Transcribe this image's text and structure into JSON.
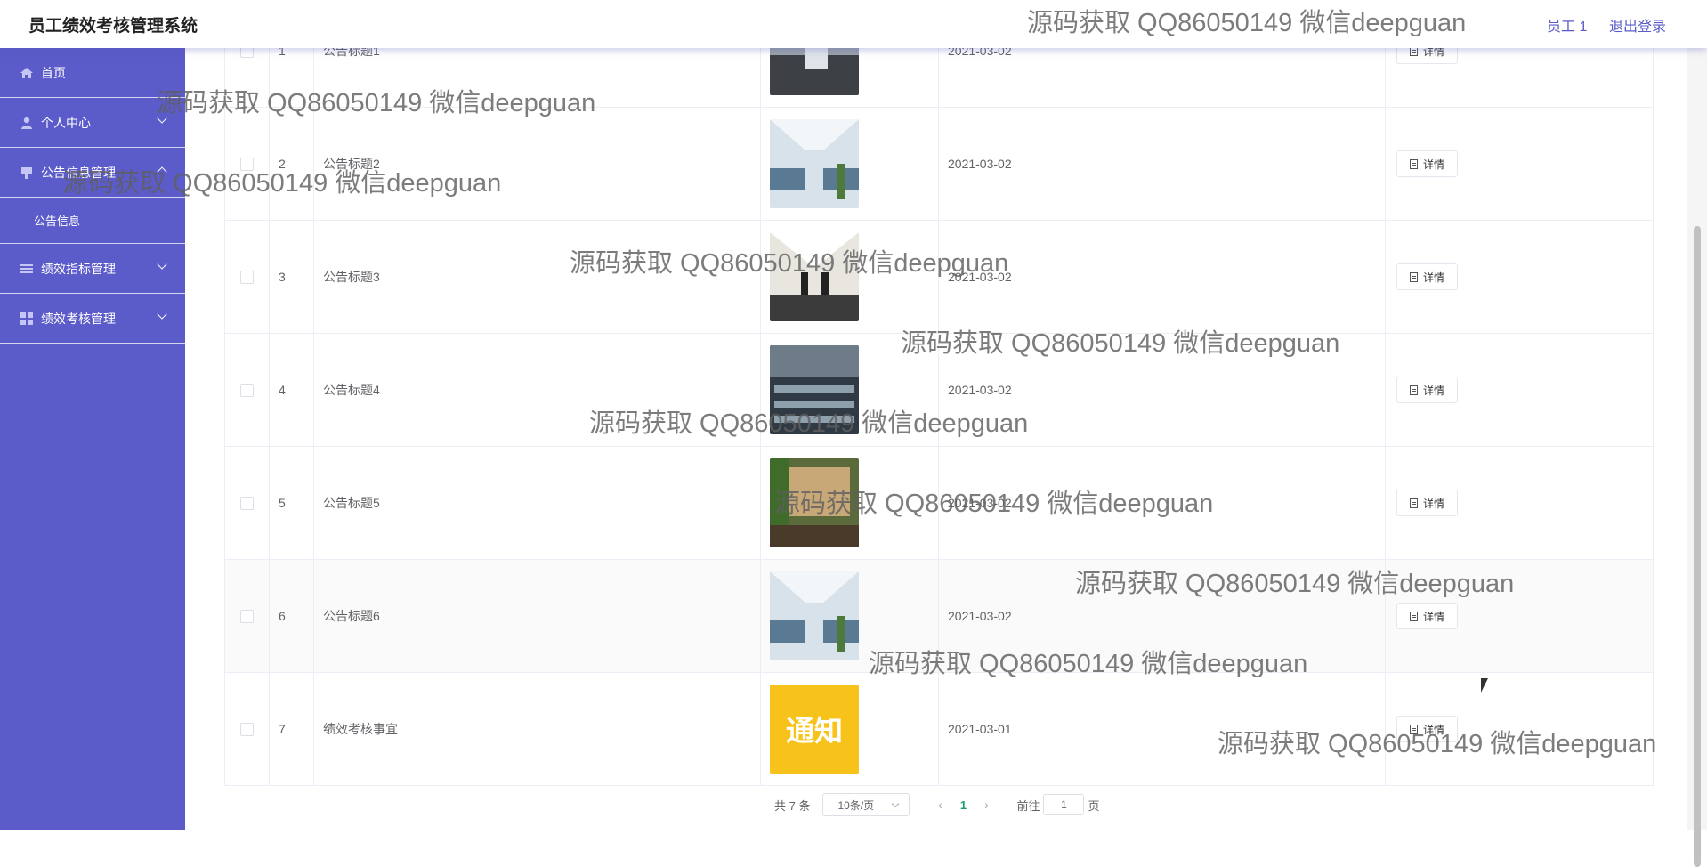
{
  "header": {
    "title": "员工绩效考核管理系统",
    "user": "员工 1",
    "logout": "退出登录"
  },
  "sidebar": {
    "items": [
      {
        "label": "首页",
        "icon": "home-icon"
      },
      {
        "label": "个人中心",
        "icon": "user-icon"
      },
      {
        "label": "公告信息管理",
        "icon": "bulletin-icon"
      },
      {
        "label": "公告信息",
        "icon": ""
      },
      {
        "label": "绩效指标管理",
        "icon": "list-icon"
      },
      {
        "label": "绩效考核管理",
        "icon": "grid-icon"
      }
    ],
    "bg_color": "#5b5bc9"
  },
  "table": {
    "rows": [
      {
        "index": "1",
        "title": "公告标题1",
        "date": "2021-03-02",
        "action": "详情"
      },
      {
        "index": "2",
        "title": "公告标题2",
        "date": "2021-03-02",
        "action": "详情"
      },
      {
        "index": "3",
        "title": "公告标题3",
        "date": "2021-03-02",
        "action": "详情"
      },
      {
        "index": "4",
        "title": "公告标题4",
        "date": "2021-03-02",
        "action": "详情"
      },
      {
        "index": "5",
        "title": "公告标题5",
        "date": "2021-03-02",
        "action": "详情"
      },
      {
        "index": "6",
        "title": "公告标题6",
        "date": "2021-03-02",
        "action": "详情"
      },
      {
        "index": "7",
        "title": "绩效考核事宜",
        "date": "2021-03-01",
        "action": "详情"
      }
    ],
    "notice_image_text": "通知"
  },
  "pagination": {
    "total": "共 7 条",
    "page_size": "10条/页",
    "current_page": "1",
    "goto_prefix": "前往",
    "goto_value": "1",
    "goto_suffix": "页"
  },
  "watermark": "源码获取 QQ86050149 微信deepguan"
}
